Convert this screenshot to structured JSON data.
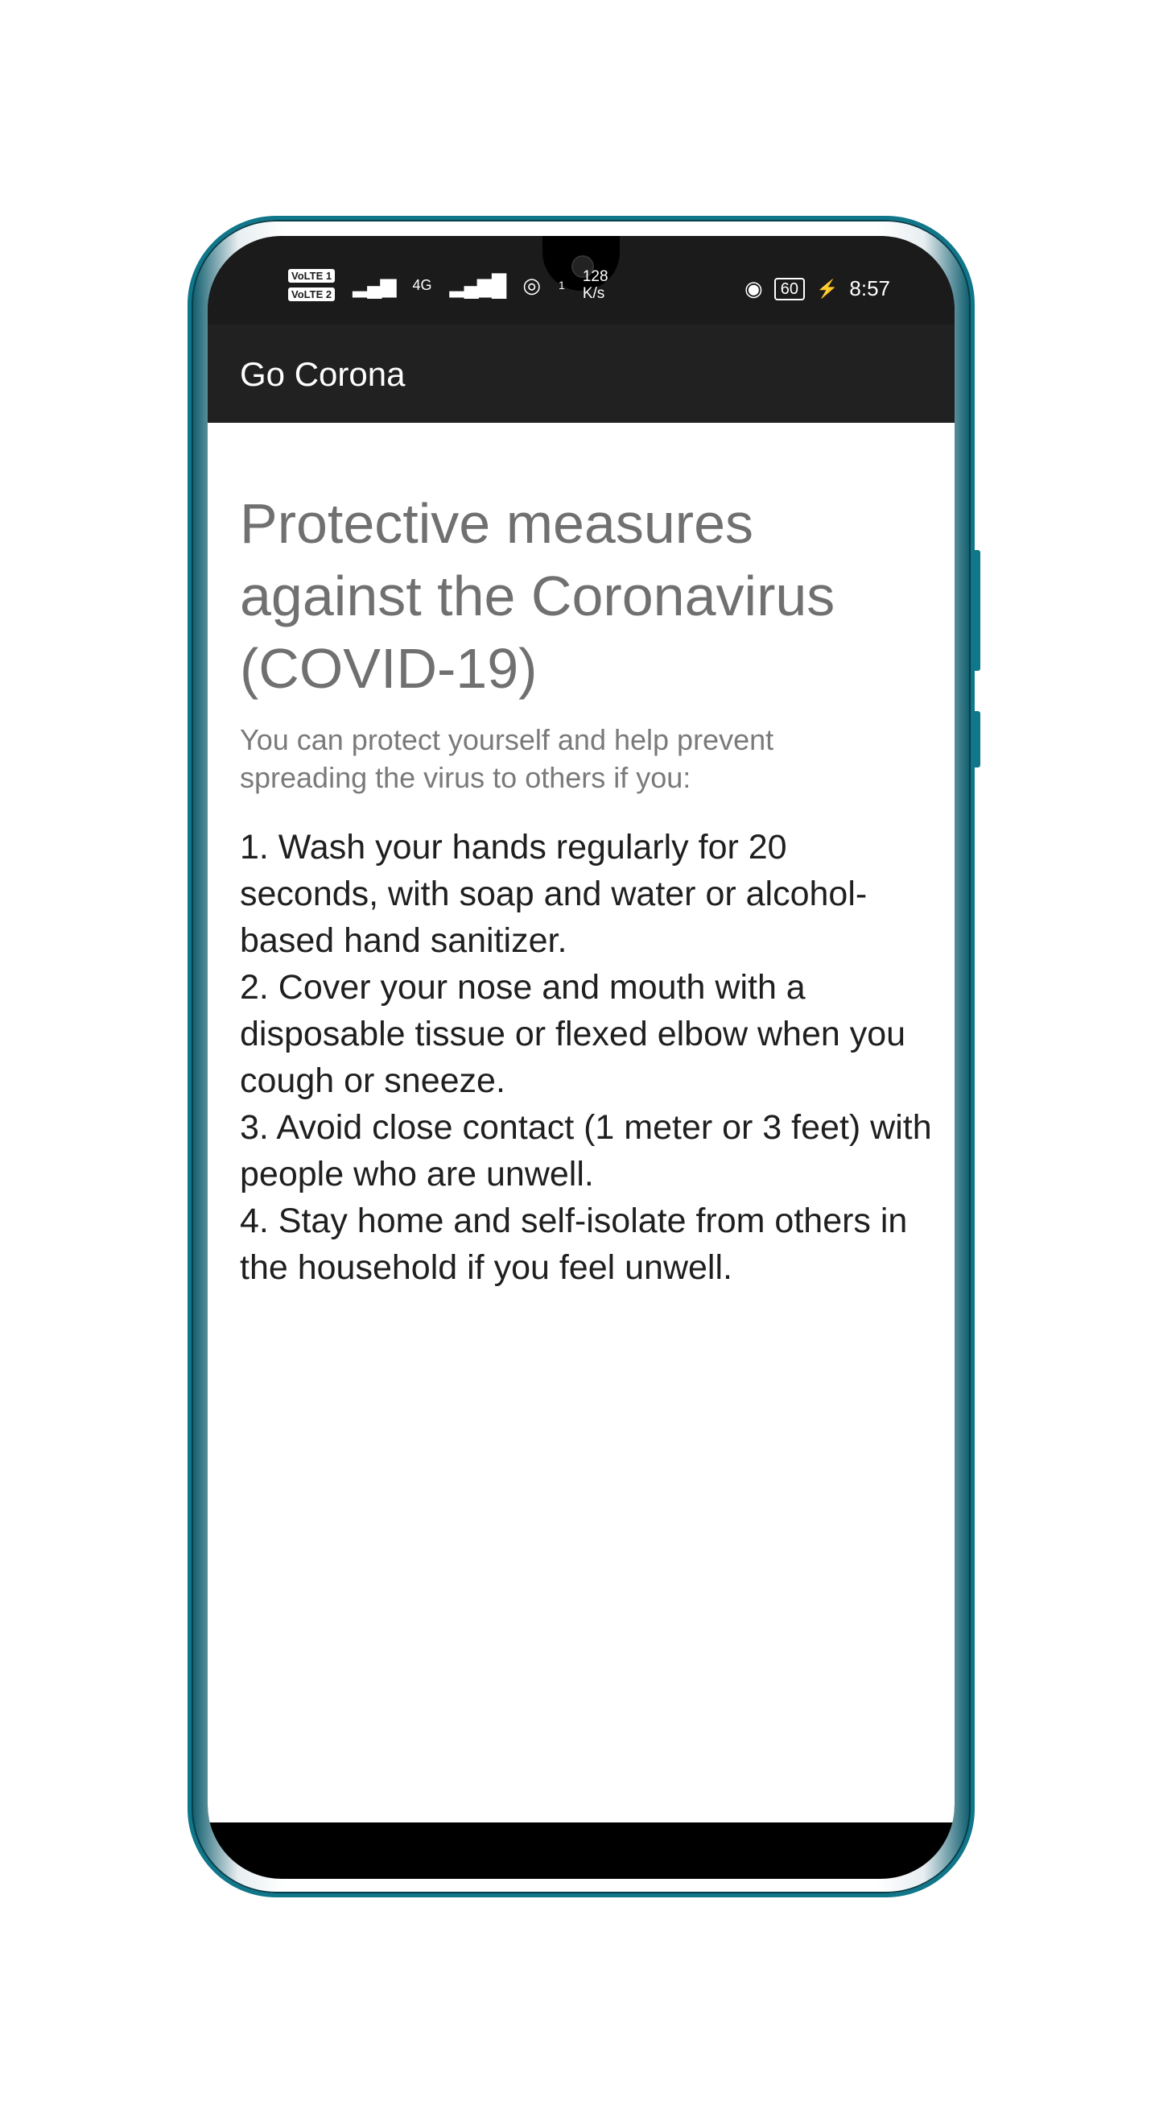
{
  "status_bar": {
    "volte_1": "VoLTE 1",
    "volte_2": "VoLTE 2",
    "network": "4G",
    "data_speed_value": "128",
    "data_speed_unit": "K/s",
    "hotspot_count": "1",
    "battery": "60",
    "time": "8:57"
  },
  "app_bar": {
    "title": "Go Corona"
  },
  "main": {
    "heading": "Protective measures against the Coronavirus (COVID-19)",
    "subtitle": "You can protect yourself and help prevent spreading the virus to others if you:",
    "measures": "1. Wash your hands regularly for 20 seconds, with soap and water or alcohol-based hand sanitizer.\n 2. Cover your nose and mouth with a disposable tissue or flexed elbow when you cough or sneeze.\n 3. Avoid close contact (1 meter or 3 feet) with people who are unwell.\n 4. Stay home and self-isolate from others in the household if you feel unwell."
  },
  "colors": {
    "appbar": "#212121",
    "phone_frame": "#10768a",
    "heading": "#707070"
  }
}
